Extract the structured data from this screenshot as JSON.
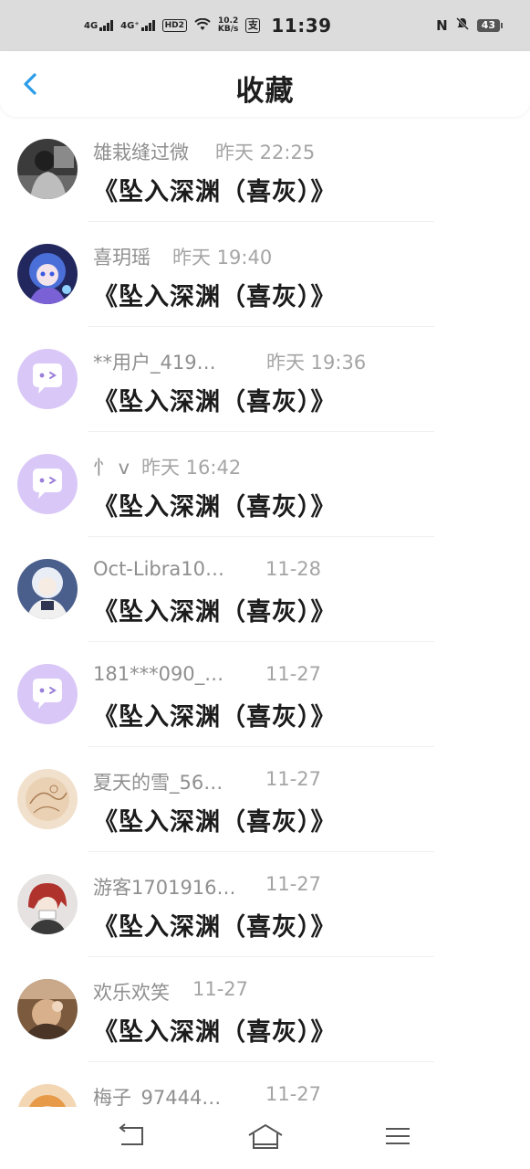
{
  "status_bar": {
    "network1": "4G",
    "network2": "4G⁺",
    "hd": "HD2",
    "speed_top": "10.2",
    "speed_bottom": "KB/s",
    "pay_icon_text": "支",
    "time": "11:39",
    "nfc_icon": "N",
    "mute_icon": "🔕",
    "battery": "43"
  },
  "header": {
    "title": "收藏",
    "accent_color": "#2a9de8"
  },
  "favorites": [
    {
      "user": "雄栽缝过微",
      "time": "昨天 22:25",
      "work": "《坠入深渊（喜灰）》",
      "avatar": "dark-portrait"
    },
    {
      "user": "喜玥瑶",
      "time": "昨天 19:40",
      "work": "《坠入深渊（喜灰）》",
      "avatar": "anime-blue"
    },
    {
      "user": "**用户_419…",
      "time": "昨天 19:36",
      "work": "《坠入深渊（喜灰）》",
      "avatar": "default-chat"
    },
    {
      "user": "忄 v",
      "time": "昨天 16:42",
      "work": "《坠入深渊（喜灰）》",
      "avatar": "default-chat"
    },
    {
      "user": "Oct-Libra10…",
      "time": "11-28",
      "work": "《坠入深渊（喜灰）》",
      "avatar": "anime-white"
    },
    {
      "user": "181***090_…",
      "time": "11-27",
      "work": "《坠入深渊（喜灰）》",
      "avatar": "default-chat"
    },
    {
      "user": "夏天的雪_56…",
      "time": "11-27",
      "work": "《坠入深渊（喜灰）》",
      "avatar": "sketch-beige"
    },
    {
      "user": "游客1701916…",
      "time": "11-27",
      "work": "《坠入深渊（喜灰）》",
      "avatar": "anime-red"
    },
    {
      "user": "欢乐欢笑",
      "time": "11-27",
      "work": "《坠入深渊（喜灰）》",
      "avatar": "photo-warm"
    },
    {
      "user": "梅子_97444…",
      "time": "11-27",
      "work": "",
      "avatar": "photo-orange"
    }
  ],
  "nav_bar": {
    "back": "back-icon",
    "home": "home-icon",
    "menu": "menu-icon"
  }
}
